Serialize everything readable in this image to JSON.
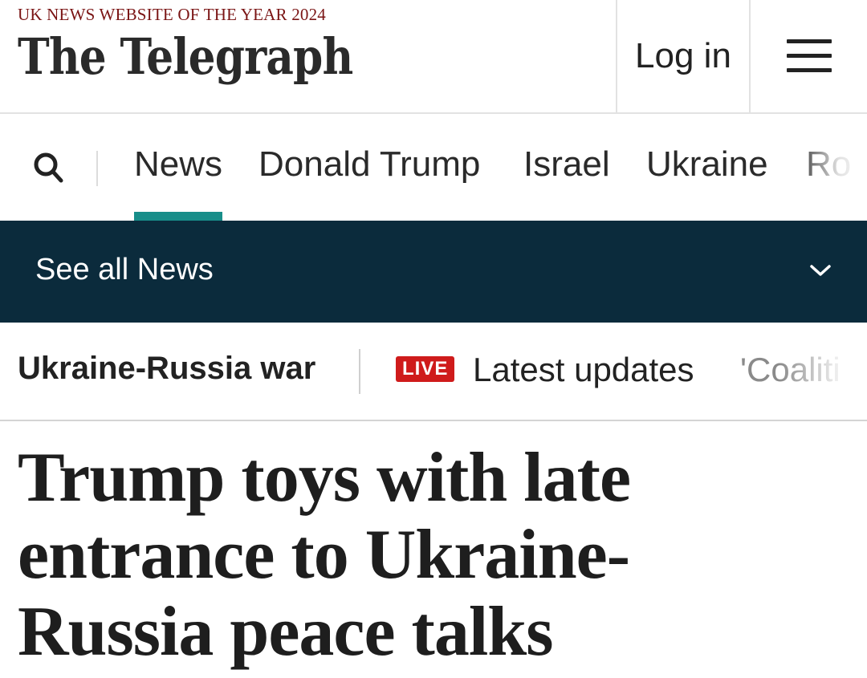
{
  "header": {
    "award": "UK NEWS WEBSITE OF THE YEAR 2024",
    "logo": "The Telegraph",
    "login_label": "Log in",
    "menu_icon": "hamburger-icon"
  },
  "nav": {
    "search_icon": "search-icon",
    "items": [
      {
        "label": "News",
        "active": true
      },
      {
        "label": "Donald Trump"
      },
      {
        "label": "Israel"
      },
      {
        "label": "Ukraine"
      },
      {
        "label": "Ro"
      }
    ],
    "active_color": "#188e8a"
  },
  "section_bar": {
    "label": "See all News",
    "icon": "chevron-down-icon",
    "background": "#0b2b3c"
  },
  "topics": {
    "title": "Ukraine-Russia war",
    "live_badge": "LIVE",
    "live_color": "#cf1b1b",
    "latest_label": "Latest updates",
    "next_item": "'Coaliti"
  },
  "article": {
    "headline": "Trump toys with late entrance to Ukraine-Russia peace talks"
  }
}
